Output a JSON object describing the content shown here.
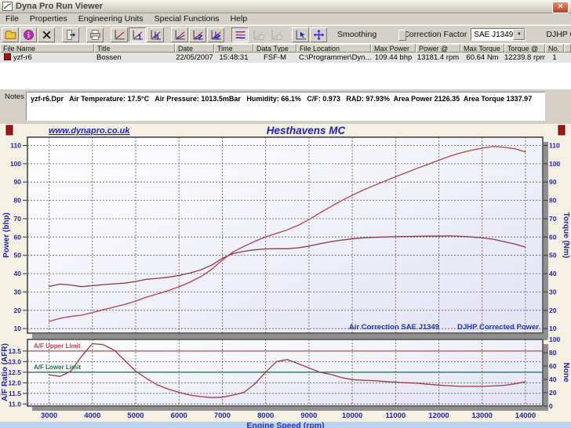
{
  "window": {
    "title": "Dyna Pro Run Viewer",
    "close_glyph": "✕"
  },
  "menu": {
    "items": [
      "File",
      "Properties",
      "Engineering Units",
      "Special Functions",
      "Help"
    ]
  },
  "toolbar": {
    "smoothing_label": "Smoothing",
    "correction_factor_label": "Correction Factor",
    "correction_factor_value": "SAE J1349",
    "dropdown_arrow": "▼",
    "djhp_label": "DJHP Correction",
    "djhp_checked": true,
    "djhp_check_glyph": "✓",
    "icons": [
      {
        "name": "open-run-icon",
        "glyph": "folder"
      },
      {
        "name": "run-info-icon",
        "glyph": "info"
      },
      {
        "name": "delete-run-icon",
        "glyph": "xmark"
      },
      {
        "name": "exit-icon",
        "glyph": "exit",
        "gap": true
      },
      {
        "name": "print-icon",
        "glyph": "print",
        "gap": true
      },
      {
        "name": "graph-view-icon",
        "glyph": "chart",
        "gap": true
      },
      {
        "name": "graph-1-icon",
        "glyph": "chart",
        "digit": "1",
        "pressed": true
      },
      {
        "name": "graph-1-cursor-icon",
        "glyph": "chart",
        "digit": "1",
        "cursor": true
      },
      {
        "name": "graph-multi-icon",
        "glyph": "chart2",
        "gap": true
      },
      {
        "name": "graph-2-icon",
        "glyph": "chart2",
        "digit": "2"
      },
      {
        "name": "graph-2-cursor-icon",
        "glyph": "chart2",
        "digit": "2",
        "cursor": true
      },
      {
        "name": "graph-overlay-icon",
        "glyph": "overlay",
        "gap": true,
        "pressed": true
      },
      {
        "name": "graph-overlay-2-icon",
        "glyph": "chartgray",
        "disabled": true
      },
      {
        "name": "graph-overlay-3-icon",
        "glyph": "chartgray",
        "disabled": true
      },
      {
        "name": "pointer-mode-icon",
        "glyph": "pointer",
        "gap": true
      },
      {
        "name": "split-cursor-icon",
        "glyph": "split"
      }
    ]
  },
  "table": {
    "columns": [
      "File Name",
      "Title",
      "Date",
      "Time",
      "Data Type",
      "File Location",
      "Max Power",
      "Power @",
      "Max Torque",
      "Torque @",
      "No."
    ],
    "rows": [
      {
        "file_name": "yzf-r6",
        "title": "Bossen",
        "date": "22/05/2007",
        "time": "15:48:31",
        "data_type": "FSF-M",
        "file_location": "C:\\Programmer\\Dyn...",
        "max_power": "109.44 bhp",
        "power_at": "13181.4 rpm",
        "max_torque": "60.64 Nm",
        "torque_at": "12239.8 rpm",
        "no": "1"
      }
    ]
  },
  "notes": {
    "label": "Notes",
    "text": "yzf-r6.Dpr   Air Temperature: 17.5°C   Air Pressure: 1013.5mBar   Humidity: 66.1%   C/F: 0.973   RAD: 97.93%  Area Power 2126.35  Area Torque 1337.97"
  },
  "chart_header": {
    "website": "www.dynapro.co.uk",
    "title": "Hesthavens MC"
  },
  "chart_data": [
    {
      "type": "line",
      "title": "Hesthavens MC",
      "xlabel": "Engine Speed (rpm)",
      "ylabel_left": "Power (bhp)",
      "ylabel_right": "Torque (Nm)",
      "xlim": [
        2500,
        14400
      ],
      "ylim": [
        7.5,
        114.5
      ],
      "x_ticks": [
        3000,
        4000,
        5000,
        6000,
        7000,
        8000,
        9000,
        10000,
        11000,
        12000,
        13000,
        14000
      ],
      "y_ticks": [
        10,
        20,
        30,
        40,
        50,
        60,
        70,
        80,
        90,
        100,
        110
      ],
      "grid": true,
      "annotation_left": "Air Correction SAE J1349",
      "annotation_right": "DJHP Corrected Power",
      "x": [
        3000,
        3250,
        3500,
        3750,
        4000,
        4250,
        4500,
        4750,
        5000,
        5250,
        5500,
        5750,
        6000,
        6250,
        6500,
        6750,
        7000,
        7250,
        7500,
        7750,
        8000,
        8250,
        8500,
        8750,
        9000,
        9250,
        9500,
        9750,
        10000,
        10250,
        10500,
        10750,
        11000,
        11250,
        11500,
        11750,
        12000,
        12250,
        12500,
        12750,
        13000,
        13250,
        13500,
        13750,
        14000
      ],
      "series": [
        {
          "name": "Power (bhp)",
          "color": "#b2434b",
          "values": [
            13.9,
            15.6,
            16.6,
            17.3,
            18.7,
            20.3,
            21.7,
            23.2,
            25.0,
            27.2,
            28.9,
            30.7,
            32.8,
            35.3,
            38.3,
            42.2,
            47.4,
            51.9,
            54.9,
            57.6,
            60.1,
            62.0,
            63.9,
            66.4,
            69.5,
            73.1,
            76.5,
            79.8,
            82.8,
            85.6,
            88.1,
            90.5,
            92.9,
            95.2,
            97.5,
            99.7,
            101.9,
            104.1,
            105.9,
            107.3,
            108.5,
            109.4,
            109.0,
            108.2,
            106.5
          ]
        },
        {
          "name": "Torque (Nm)",
          "color": "#8a3a42",
          "values": [
            33.0,
            34.3,
            33.8,
            32.9,
            33.4,
            34.0,
            34.4,
            34.8,
            35.7,
            36.9,
            37.4,
            38.0,
            39.0,
            40.3,
            42.0,
            44.6,
            48.3,
            51.0,
            52.2,
            53.0,
            53.5,
            53.6,
            53.6,
            54.1,
            55.0,
            56.3,
            57.4,
            58.3,
            59.0,
            59.5,
            59.8,
            60.0,
            60.2,
            60.3,
            60.4,
            60.5,
            60.5,
            60.6,
            60.4,
            60.0,
            59.5,
            58.8,
            57.5,
            56.2,
            54.5
          ]
        }
      ]
    },
    {
      "type": "line",
      "xlabel": "Engine Speed (rpm)",
      "ylabel_left": "A/F Ratio (AFR)",
      "ylabel_right": "None",
      "xlim": [
        2500,
        14400
      ],
      "ylim": [
        10.9,
        14.05
      ],
      "x_ticks": [
        3000,
        4000,
        5000,
        6000,
        7000,
        8000,
        9000,
        10000,
        11000,
        12000,
        13000,
        14000
      ],
      "y_ticks_left": [
        11.0,
        11.5,
        12.0,
        12.5,
        13.0,
        13.5
      ],
      "y_ticks_right": [
        0,
        20,
        40,
        60,
        80,
        100
      ],
      "grid": true,
      "limit_lines": [
        {
          "label": "A/F Upper Limit",
          "value": 13.5,
          "color": "#b85c64"
        },
        {
          "label": "A/F Lower Limit",
          "value": 12.5,
          "color": "#2a7a50"
        }
      ],
      "x": [
        3000,
        3250,
        3500,
        3750,
        4000,
        4250,
        4500,
        4750,
        5000,
        5250,
        5500,
        5750,
        6000,
        6250,
        6500,
        6750,
        7000,
        7250,
        7500,
        7750,
        8000,
        8250,
        8500,
        8750,
        9000,
        9250,
        9500,
        9750,
        10000,
        10250,
        10500,
        10750,
        11000,
        11250,
        11500,
        11750,
        12000,
        12250,
        12500,
        12750,
        13000,
        13250,
        13500,
        13750,
        14000
      ],
      "series": [
        {
          "name": "A/F Ratio",
          "color": "#9c3a42",
          "values": [
            12.38,
            12.3,
            12.55,
            13.25,
            13.85,
            13.8,
            13.55,
            13.05,
            12.55,
            12.2,
            11.9,
            11.7,
            11.55,
            11.42,
            11.35,
            11.3,
            11.32,
            11.42,
            11.55,
            11.95,
            12.5,
            13.0,
            13.1,
            12.9,
            12.7,
            12.5,
            12.4,
            12.25,
            12.15,
            12.12,
            12.1,
            12.06,
            12.03,
            12.0,
            11.98,
            11.93,
            11.89,
            11.86,
            11.83,
            11.83,
            11.83,
            11.85,
            11.88,
            11.95,
            12.05
          ]
        }
      ]
    }
  ],
  "colors": {
    "accent_blue": "#2424aa",
    "curve_red": "#b2434b",
    "limit_upper": "#b85c64",
    "limit_lower": "#2a7a50",
    "panel_cream": "#f4f0e3",
    "window_gray": "#d4d0c8"
  }
}
